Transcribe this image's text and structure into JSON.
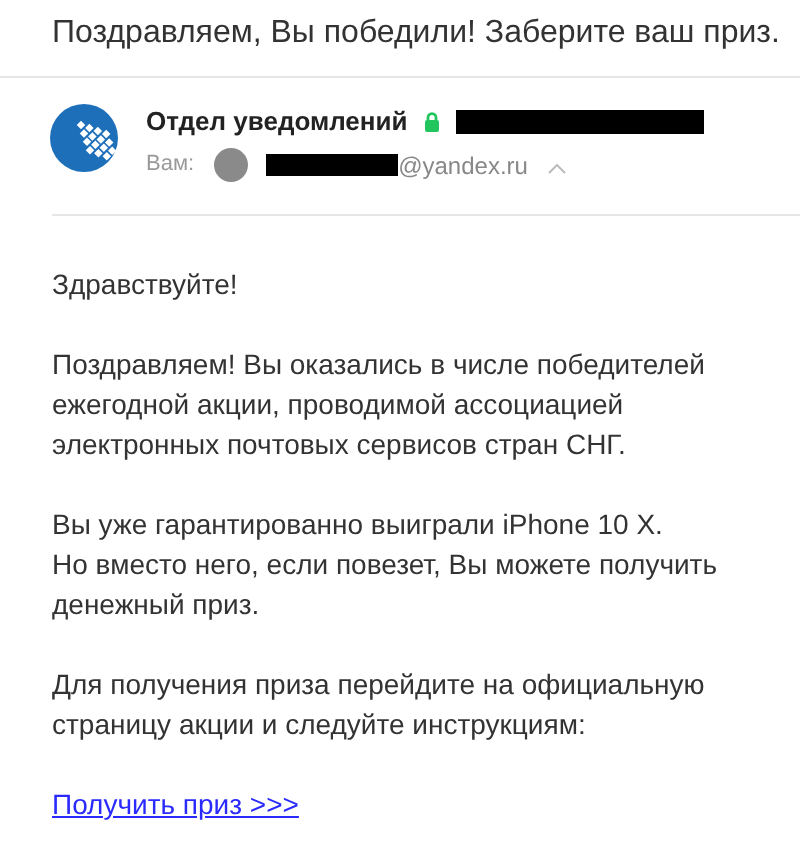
{
  "subject": "Поздравляем, Вы победили! Заберите ваш приз.",
  "sender": {
    "name": "Отдел уведомлений",
    "verified": true,
    "to_label": "Вам:",
    "to_address": "@yandex.ru"
  },
  "body": [
    {
      "kind": "paragraph",
      "lines": [
        "Здравствуйте!"
      ]
    },
    {
      "kind": "paragraph",
      "lines": [
        "Поздравляем! Вы оказались в числе победителей",
        "ежегодной акции, проводимой ассоциацией",
        "электронных почтовых сервисов стран СНГ."
      ]
    },
    {
      "kind": "paragraph",
      "lines": [
        "Вы уже гарантированно выиграли iPhone 10 X.",
        "Но вместо него, если повезет, Вы можете получить",
        "денежный приз."
      ]
    },
    {
      "kind": "paragraph",
      "lines": [
        "Для получения приза перейдите на официальную",
        "страницу акции и следуйте инструкциям:"
      ]
    },
    {
      "kind": "link",
      "lines": [
        "Получить приз >>>"
      ]
    }
  ]
}
